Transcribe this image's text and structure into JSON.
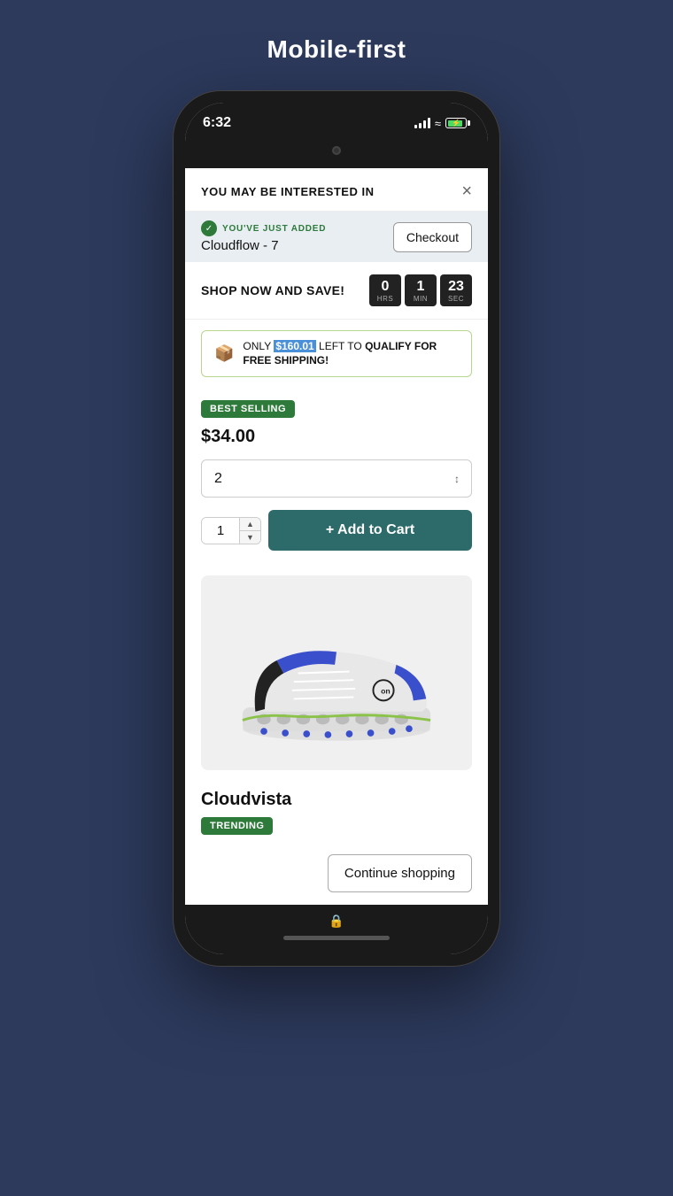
{
  "page": {
    "title": "Mobile-first"
  },
  "status_bar": {
    "time": "6:32",
    "signal_label": "signal",
    "wifi_label": "wifi",
    "battery_label": "battery"
  },
  "modal": {
    "title": "YOU MAY BE INTERESTED IN",
    "close_label": "×"
  },
  "added_banner": {
    "check_icon": "✓",
    "added_label": "YOU'VE JUST ADDED",
    "product_name": "Cloudflow - 7",
    "checkout_label": "Checkout"
  },
  "timer_section": {
    "label": "SHOP NOW AND SAVE!",
    "hours": {
      "value": "0",
      "unit": "HRS"
    },
    "minutes": {
      "value": "1",
      "unit": "MIN"
    },
    "seconds": {
      "value": "23",
      "unit": "SEC"
    }
  },
  "shipping_banner": {
    "box_icon": "📦",
    "text_before": "ONLY ",
    "amount": "$160.01",
    "text_middle": " LEFT TO ",
    "text_after": "QUALIFY FOR FREE SHIPPING!"
  },
  "product": {
    "badge_best": "BEST SELLING",
    "price": "$34.00",
    "size_value": "2",
    "quantity": "1",
    "add_to_cart_label": "+ Add to Cart",
    "name": "Cloudvista",
    "badge_trending": "TRENDING"
  },
  "footer": {
    "continue_label": "Continue shopping"
  },
  "colors": {
    "background": "#2d3a5c",
    "dark_button": "#2d6a6a",
    "green_badge": "#2d7a3a",
    "blue_highlight": "#4a90d9"
  }
}
